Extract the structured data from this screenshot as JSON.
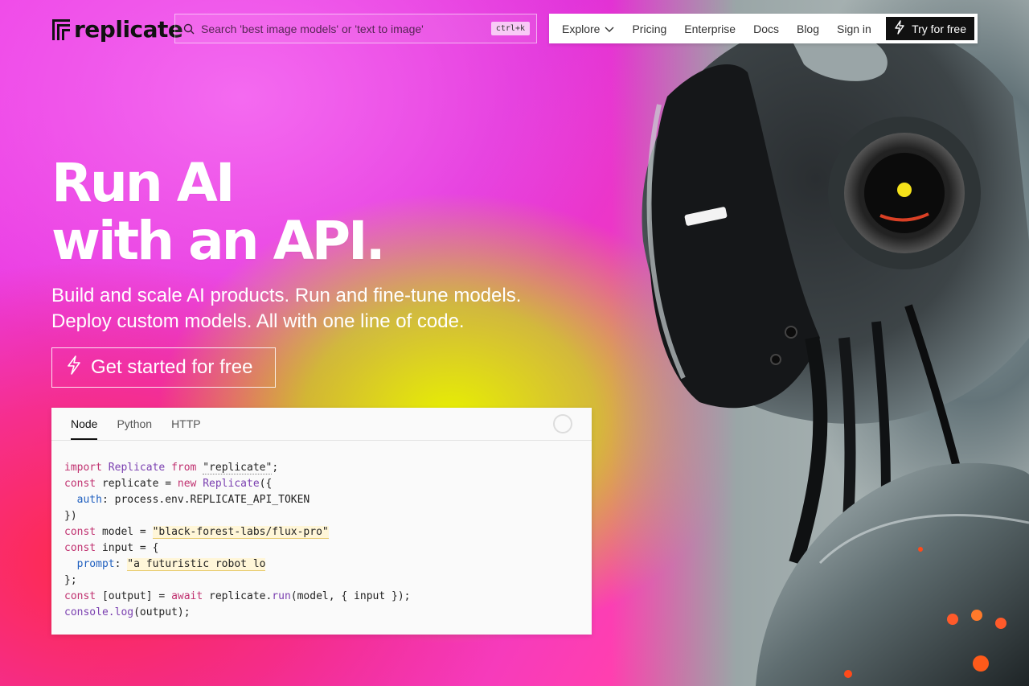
{
  "header": {
    "logo_text": "replicate",
    "search_placeholder": "Search 'best image models' or 'text to image'",
    "search_shortcut": "ctrl+k",
    "nav": [
      {
        "label": "Explore"
      },
      {
        "label": "Pricing"
      },
      {
        "label": "Enterprise"
      },
      {
        "label": "Docs"
      },
      {
        "label": "Blog"
      },
      {
        "label": "Sign in"
      }
    ],
    "cta_label": "Try for free"
  },
  "hero": {
    "title_line1": "Run AI",
    "title_line2": "with an API.",
    "subtitle_line1": "Build and scale AI products. Run and fine-tune models.",
    "subtitle_line2": "Deploy custom models. All with one line of code.",
    "cta_label": "Get started for free"
  },
  "code_panel": {
    "tabs": [
      "Node",
      "Python",
      "HTTP"
    ],
    "active_tab": "Node",
    "lines": {
      "l1_kw": "import",
      "l1_cls": "Replicate",
      "l1_kw2": "from",
      "l1_str": "\"replicate\"",
      "l1_end": ";",
      "l2_kw": "const",
      "l2_var": " replicate = ",
      "l2_kw2": "new",
      "l2_cls": "Replicate",
      "l2_end": "({",
      "l3_prop": "auth",
      "l3_rest": ": process.env.REPLICATE_API_TOKEN",
      "l4": "})",
      "l5_kw": "const",
      "l5_var": " model = ",
      "l5_str": "\"black-forest-labs/flux-pro\"",
      "l6_kw": "const",
      "l6_var": " input = {",
      "l7_prop": "prompt",
      "l7_colon": ": ",
      "l7_str": "\"a futuristic robot lo",
      "l8": "};",
      "l9_kw": "const",
      "l9_var": " [output] = ",
      "l9_kw2": "await",
      "l9_obj": " replicate.",
      "l9_fn": "run",
      "l9_end": "(model, { input });",
      "l10_obj": "console.",
      "l10_fn": "log",
      "l10_end": "(output);"
    }
  },
  "colors": {
    "accent_dark": "#111111",
    "bg_magenta": "#e030d8",
    "bg_yellow": "#e8f000"
  }
}
